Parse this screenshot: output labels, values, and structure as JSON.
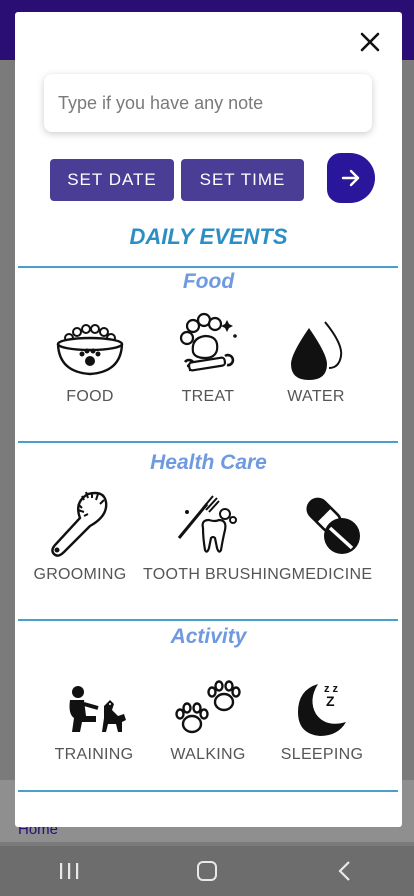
{
  "background": {
    "home_link": "Home"
  },
  "dialog": {
    "note": {
      "placeholder": "Type if you have any note"
    },
    "buttons": {
      "set_date": "SET DATE",
      "set_time": "SET TIME"
    },
    "title": "DAILY EVENTS",
    "sections": [
      {
        "title": "Food",
        "items": [
          {
            "label": "FOOD",
            "icon": "food-bowl-icon"
          },
          {
            "label": "TREAT",
            "icon": "bone-treat-icon"
          },
          {
            "label": "WATER",
            "icon": "water-drop-icon"
          }
        ]
      },
      {
        "title": "Health Care",
        "items": [
          {
            "label": "GROOMING",
            "icon": "brush-icon"
          },
          {
            "label": "TOOTH BRUSHING",
            "icon": "toothbrush-icon"
          },
          {
            "label": "MEDICINE",
            "icon": "pill-icon"
          }
        ]
      },
      {
        "title": "Activity",
        "items": [
          {
            "label": "TRAINING",
            "icon": "training-icon"
          },
          {
            "label": "WALKING",
            "icon": "paw-prints-icon"
          },
          {
            "label": "SLEEPING",
            "icon": "moon-sleep-icon"
          }
        ]
      }
    ]
  },
  "colors": {
    "primary_button": "#4a3d96",
    "fab": "#2a169a",
    "header_title": "#2b8ec4",
    "section_title": "#6f9ae0",
    "status_bar": "#2a0e73"
  }
}
